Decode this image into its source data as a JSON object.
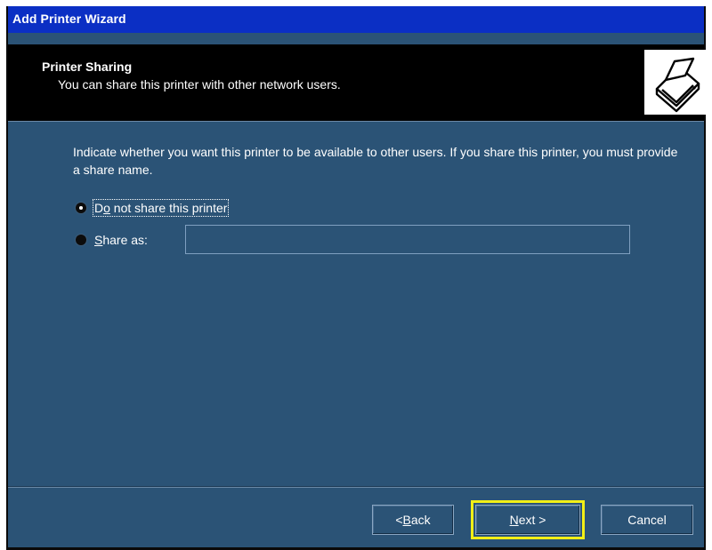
{
  "window": {
    "title": "Add Printer Wizard"
  },
  "header": {
    "title": "Printer Sharing",
    "subtitle": "You can share this printer with other network users.",
    "icon": "printer-icon"
  },
  "body": {
    "instructions": "Indicate whether you want this printer to be available to other users. If you share this printer, you must provide a share name.",
    "options": [
      {
        "label_pre": "D",
        "label_accel": "o",
        "label_post": " not share this printer",
        "checked": true
      },
      {
        "label_pre": "",
        "label_accel": "S",
        "label_post": "hare as:",
        "checked": false
      }
    ],
    "share_name_value": ""
  },
  "buttons": {
    "back_pre": "< ",
    "back_accel": "B",
    "back_post": "ack",
    "next_accel": "N",
    "next_post": "ext >",
    "cancel": "Cancel"
  },
  "colors": {
    "titlebar": "#0b2fc4",
    "dialog_bg": "#2b5376",
    "header_bg": "#000000",
    "highlight": "#f2ef17"
  }
}
